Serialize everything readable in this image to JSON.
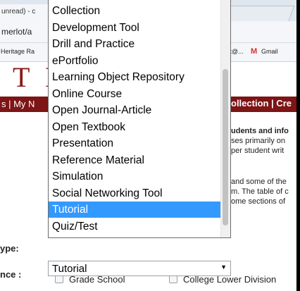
{
  "browser": {
    "tab_title": "unread) - c",
    "address": "merlot/a",
    "bookmarks": [
      {
        "label": "Heritage Ra"
      },
      {
        "label": "swift@..."
      },
      {
        "label": "Gmail"
      }
    ]
  },
  "page": {
    "logo_text": "T II",
    "nav_left": "s | My N",
    "nav_right": "ollection | Cre",
    "right_lines": [
      "udents and info",
      "ses primarily on",
      "per student writ",
      "and some of the",
      "m. The table of c",
      "ome sections of"
    ],
    "type_label": "ype:",
    "audience_label": "nce :",
    "checkboxes": [
      {
        "label": "Grade School"
      },
      {
        "label": "College Lower Division"
      }
    ]
  },
  "dropdown": {
    "options": [
      "Collection",
      "Development Tool",
      "Drill and Practice",
      "ePortfolio",
      "Learning Object Repository",
      "Online Course",
      "Open Journal-Article",
      "Open Textbook",
      "Presentation",
      "Reference Material",
      "Simulation",
      "Social Networking Tool",
      "Tutorial",
      "Quiz/Test"
    ],
    "selected_index": 12,
    "selected_value": "Tutorial",
    "colors": {
      "highlight": "#3399ff",
      "nav": "#7d1416",
      "logo": "#8b1a1a"
    }
  }
}
